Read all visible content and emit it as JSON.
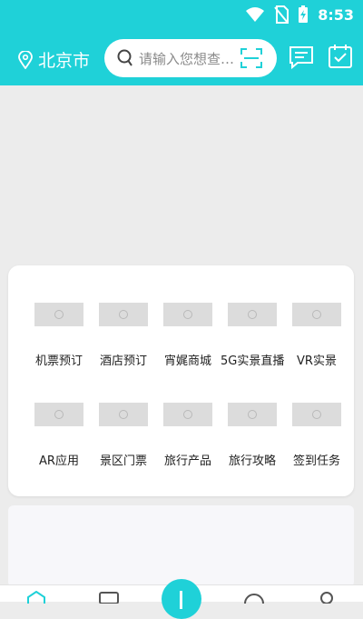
{
  "status_bar": {
    "time": "8:53"
  },
  "header": {
    "location_label": "北京市",
    "search_placeholder": "请输入您想查找的..."
  },
  "menu": {
    "items": [
      {
        "label": "机票预订"
      },
      {
        "label": "酒店预订"
      },
      {
        "label": "宵娓商城"
      },
      {
        "label": "5G实景直播"
      },
      {
        "label": "VR实景"
      },
      {
        "label": "AR应用"
      },
      {
        "label": "景区门票"
      },
      {
        "label": "旅行产品"
      },
      {
        "label": "旅行攻略"
      },
      {
        "label": "签到任务"
      }
    ]
  },
  "colors": {
    "brand": "#1fd1d8",
    "background": "#ececec"
  }
}
